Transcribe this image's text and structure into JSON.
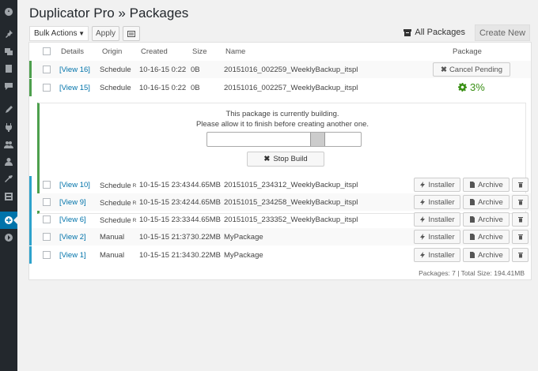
{
  "page": {
    "title": "Duplicator Pro » Packages"
  },
  "toolbar": {
    "bulk_actions": "Bulk Actions",
    "apply": "Apply",
    "all_packages": "All Packages",
    "create_new": "Create New"
  },
  "table": {
    "headers": {
      "details": "Details",
      "origin": "Origin",
      "created": "Created",
      "size": "Size",
      "name": "Name",
      "package": "Package"
    },
    "pending_rows": [
      {
        "details": "[View 16]",
        "origin": "Schedule",
        "created": "10-16-15 0:22",
        "size": "0B",
        "name": "20151016_002259_WeeklyBackup_itspl",
        "action": "Cancel Pending"
      },
      {
        "details": "[View 15]",
        "origin": "Schedule",
        "created": "10-16-15 0:22",
        "size": "0B",
        "name": "20151016_002257_WeeklyBackup_itspl",
        "progress": "3%"
      }
    ],
    "building": {
      "line1": "This package is currently building.",
      "line2": "Please allow it to finish before creating another one.",
      "stop_label": "Stop Build"
    },
    "rows": [
      {
        "details": "[View 10]",
        "origin": "Schedule",
        "origin_sup": "R",
        "created": "10-15-15 23:43",
        "size": "44.65MB",
        "name": "20151015_234312_WeeklyBackup_itspl"
      },
      {
        "details": "[View 9]",
        "origin": "Schedule",
        "origin_sup": "R",
        "created": "10-15-15 23:42",
        "size": "44.65MB",
        "name": "20151015_234258_WeeklyBackup_itspl"
      },
      {
        "details": "[View 6]",
        "origin": "Schedule",
        "origin_sup": "R",
        "created": "10-15-15 23:33",
        "size": "44.65MB",
        "name": "20151015_233352_WeeklyBackup_itspl"
      },
      {
        "details": "[View 2]",
        "origin": "Manual",
        "origin_sup": "",
        "created": "10-15-15 21:37",
        "size": "30.22MB",
        "name": "MyPackage"
      },
      {
        "details": "[View 1]",
        "origin": "Manual",
        "origin_sup": "",
        "created": "10-15-15 21:34",
        "size": "30.22MB",
        "name": "MyPackage"
      }
    ],
    "installer_label": "Installer",
    "archive_label": "Archive",
    "footer": "Packages: 7 | Total Size: 194.41MB"
  }
}
